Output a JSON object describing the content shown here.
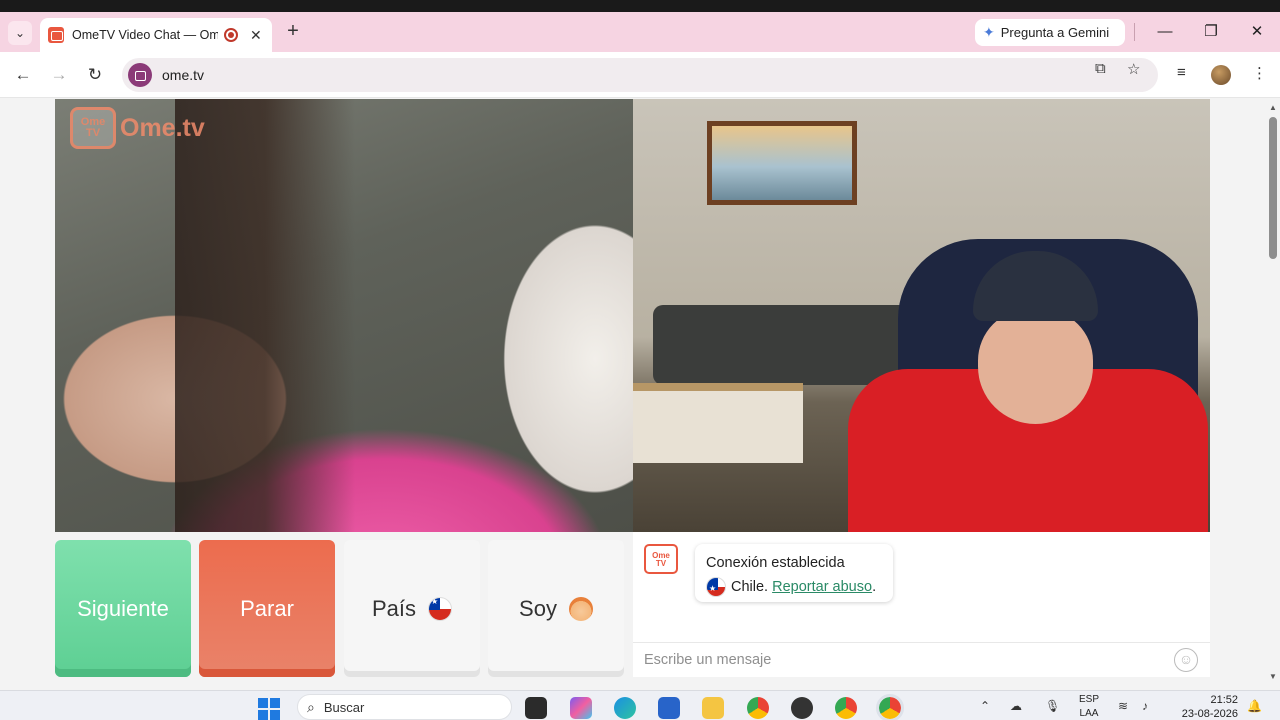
{
  "browser": {
    "tab_title": "OmeTV Video Chat — Ome",
    "new_tab_symbol": "+",
    "gemini_label": "Pregunta a Gemini",
    "url": "ome.tv",
    "window_controls": [
      "—",
      "❐",
      "✕"
    ]
  },
  "video": {
    "logo_badge": "Ome TV",
    "logo_text": "Ome.tv"
  },
  "controls": {
    "next_label": "Siguiente",
    "stop_label": "Parar",
    "country_label": "País",
    "gender_label": "Soy"
  },
  "chat": {
    "logo_badge": "Ome TV",
    "status_line": "Conexión establecida",
    "country_name": "Chile.",
    "report_link": "Reportar abuso",
    "report_suffix": ".",
    "input_placeholder": "Escribe un mensaje"
  },
  "taskbar": {
    "search_label": "Buscar",
    "lang_line1": "ESP",
    "lang_line2": "LAA",
    "time": "21:52",
    "date": "23-08-2026"
  },
  "colors": {
    "tab_bar": "#f6d4e2",
    "next_button": "#5dcf93",
    "stop_button": "#e9836a",
    "accent_link": "#2a8a66",
    "ome_orange": "#f08b6b"
  }
}
